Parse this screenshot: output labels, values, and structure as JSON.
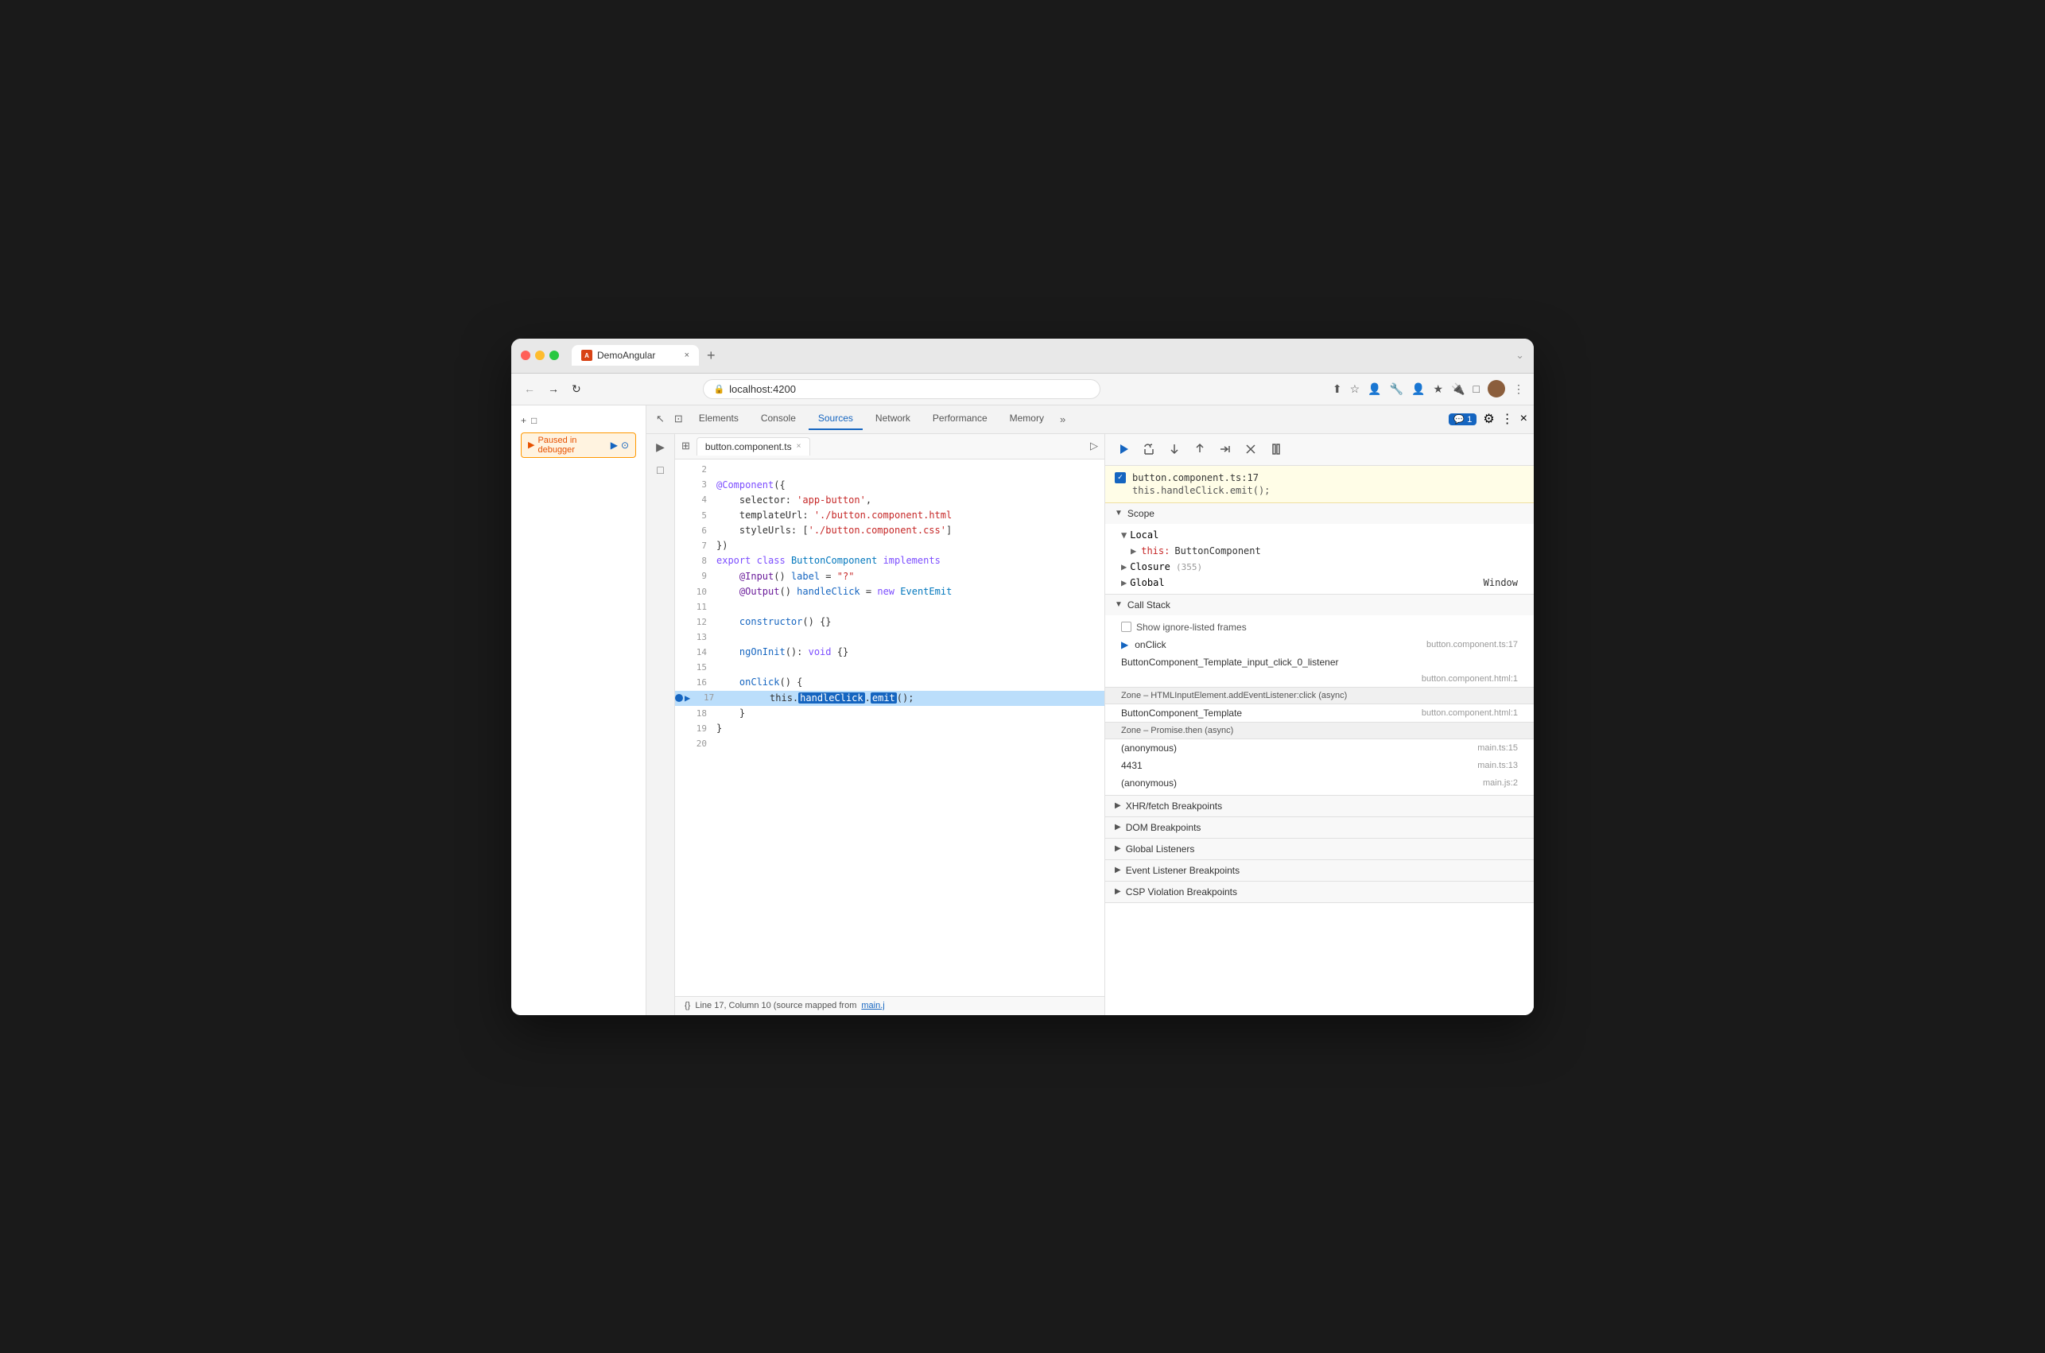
{
  "browser": {
    "tab_title": "DemoAngular",
    "tab_close": "×",
    "new_tab": "+",
    "url": "localhost:4200",
    "nav_back": "←",
    "nav_forward": "→",
    "nav_reload": "↻",
    "more_options": "⋮"
  },
  "devtools": {
    "tabs": [
      {
        "label": "Elements",
        "active": false
      },
      {
        "label": "Console",
        "active": false
      },
      {
        "label": "Sources",
        "active": true
      },
      {
        "label": "Network",
        "active": false
      },
      {
        "label": "Performance",
        "active": false
      },
      {
        "label": "Memory",
        "active": false
      }
    ],
    "comment_count": "1",
    "settings_icon": "⚙",
    "more_icon": "⋮",
    "close_icon": "×"
  },
  "file_tab": {
    "name": "button.component.ts",
    "close": "×"
  },
  "code_lines": [
    {
      "num": "2",
      "content": ""
    },
    {
      "num": "3",
      "content": "@Component({"
    },
    {
      "num": "4",
      "content": "    selector: 'app-button',"
    },
    {
      "num": "5",
      "content": "    templateUrl: './button.component.html"
    },
    {
      "num": "6",
      "content": "    styleUrls: ['./button.component.css']"
    },
    {
      "num": "7",
      "content": "})"
    },
    {
      "num": "8",
      "content": "export class ButtonComponent implements"
    },
    {
      "num": "9",
      "content": "    @Input() label = \"?\""
    },
    {
      "num": "10",
      "content": "    @Output() handleClick = new EventEmit"
    },
    {
      "num": "11",
      "content": ""
    },
    {
      "num": "12",
      "content": "    constructor() {}"
    },
    {
      "num": "13",
      "content": ""
    },
    {
      "num": "14",
      "content": "    ngOnInit(): void {}"
    },
    {
      "num": "15",
      "content": ""
    },
    {
      "num": "16",
      "content": "    onClick() {"
    },
    {
      "num": "17",
      "content": "        this.handleClick.emit();",
      "active": true,
      "has_bp": true
    },
    {
      "num": "18",
      "content": "    }"
    },
    {
      "num": "19",
      "content": "}"
    },
    {
      "num": "20",
      "content": ""
    }
  ],
  "status_bar": {
    "format_icon": "{}",
    "status_text": "Line 17, Column 10 (source mapped from",
    "link_text": "main.j"
  },
  "debugger": {
    "controls": {
      "resume": "▶",
      "step_over": "↺",
      "step_into": "↓",
      "step_out": "↑",
      "step": "→→",
      "deactivate": "✎",
      "pause": "⏸"
    },
    "breakpoint_location": "button.component.ts:17",
    "breakpoint_code": "this.handleClick.emit();",
    "scope_label": "Scope",
    "scope_sections": [
      {
        "label": "Local",
        "expanded": true,
        "items": [
          {
            "key": "▶ this:",
            "value": "ButtonComponent"
          }
        ]
      },
      {
        "label": "Closure (355)",
        "expanded": false,
        "items": []
      },
      {
        "label": "Global",
        "expanded": false,
        "value": "Window"
      }
    ],
    "call_stack_label": "Call Stack",
    "show_ignore_frames": "Show ignore-listed frames",
    "call_stack": [
      {
        "name": "onClick",
        "file": "button.component.ts:17",
        "arrow": true
      },
      {
        "name": "ButtonComponent_Template_input_click_0_listener",
        "file": ""
      },
      {
        "name": "",
        "file": "button.component.html:1"
      },
      {
        "separator": "Zone – HTMLInputElement.addEventListener:click (async)"
      },
      {
        "name": "ButtonComponent_Template",
        "file": "button.component.html:1"
      },
      {
        "separator": "Zone – Promise.then (async)"
      },
      {
        "name": "(anonymous)",
        "file": "main.ts:15"
      },
      {
        "name": "4431",
        "file": "main.ts:13"
      },
      {
        "name": "(anonymous)",
        "file": "main.js:2"
      }
    ],
    "breakpoints_label": "XHR/fetch Breakpoints",
    "dom_breakpoints_label": "DOM Breakpoints",
    "global_listeners_label": "Global Listeners",
    "event_listener_label": "Event Listener Breakpoints",
    "csp_violation_label": "CSP Violation Breakpoints"
  },
  "paused_badge": {
    "text": "Paused in debugger"
  },
  "page_controls": {
    "add_icon": "+",
    "page_icon": "□",
    "inspect_icon": "↖",
    "device_icon": "⊡"
  }
}
